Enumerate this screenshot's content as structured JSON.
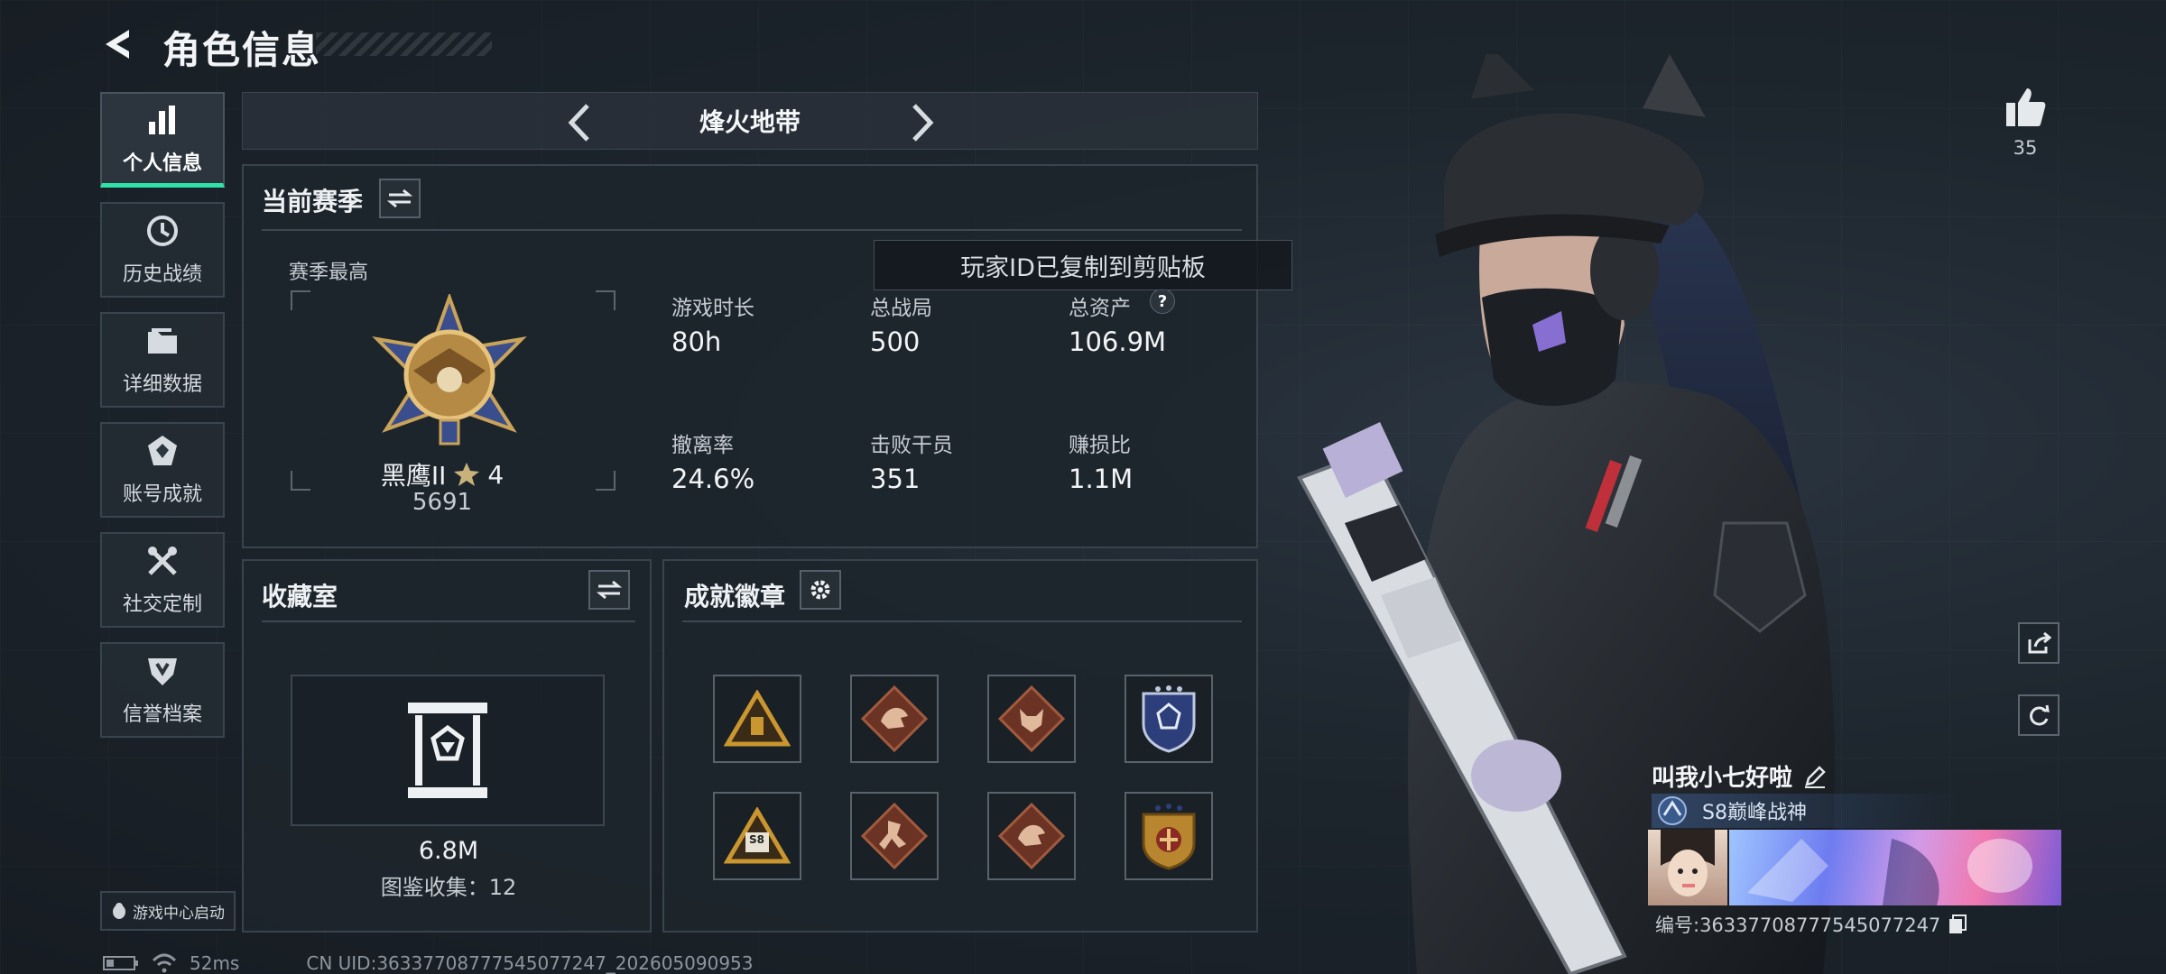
{
  "header": {
    "title": "角色信息"
  },
  "sidebar": {
    "items": [
      {
        "label": "个人信息",
        "icon": "bar-chart-icon",
        "active": true
      },
      {
        "label": "历史战绩",
        "icon": "history-icon"
      },
      {
        "label": "详细数据",
        "icon": "folder-icon"
      },
      {
        "label": "账号成就",
        "icon": "achievement-icon"
      },
      {
        "label": "社交定制",
        "icon": "tools-icon"
      },
      {
        "label": "信誉档案",
        "icon": "shield-icon"
      }
    ],
    "launch_label": "游戏中心启动"
  },
  "mode": {
    "name": "烽火地带"
  },
  "season": {
    "title": "当前赛季",
    "best_label": "赛季最高",
    "rank_name": "黑鹰II",
    "rank_stars": "4",
    "rank_points": "5691",
    "stats": [
      {
        "label": "游戏时长",
        "value": "80h"
      },
      {
        "label": "总战局",
        "value": "500"
      },
      {
        "label": "总资产",
        "value": "106.9M",
        "help": "?"
      },
      {
        "label": "撤离率",
        "value": "24.6%"
      },
      {
        "label": "击败干员",
        "value": "351"
      },
      {
        "label": "赚损比",
        "value": "1.1M"
      }
    ]
  },
  "toast": "玩家ID已复制到剪贴板",
  "collection": {
    "title": "收藏室",
    "value": "6.8M",
    "count_text": "图鉴收集：12"
  },
  "badges": {
    "title": "成就徽章",
    "items": [
      {
        "icon": "pyramid-badge-icon",
        "color": "#c9962f"
      },
      {
        "icon": "dragon-badge-icon",
        "color": "#8a4a33"
      },
      {
        "icon": "wolf-badge-icon",
        "color": "#8a4a33"
      },
      {
        "icon": "blue-shield-badge-icon",
        "color": "#3a4f8c"
      },
      {
        "icon": "s8-pyramid-badge-icon",
        "color": "#c9962f",
        "text": "S8"
      },
      {
        "icon": "runner-badge-icon",
        "color": "#8a4a33"
      },
      {
        "icon": "dragon-badge-icon",
        "color": "#8a4a33"
      },
      {
        "icon": "gold-shield-badge-icon",
        "color": "#c9962f"
      }
    ]
  },
  "likes": {
    "count": "35"
  },
  "player": {
    "name": "叫我小七好啦",
    "title": "S8巅峰战神",
    "id_text": "编号:3633770877754507724​7"
  },
  "status_bar": {
    "ping": "52ms",
    "uid": "CN UID:36337708777545077247_202605090953"
  },
  "colors": {
    "accent": "#2fe3a8",
    "panel": "#1e252c",
    "border": "#39434d"
  }
}
